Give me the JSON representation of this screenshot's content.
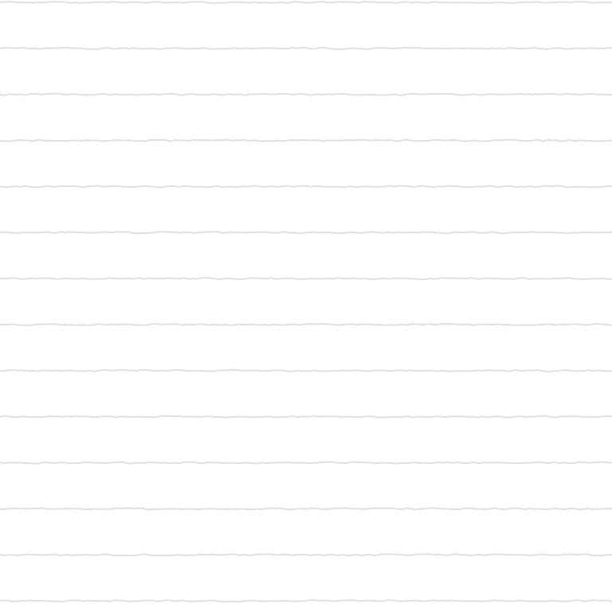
{
  "background_color": "#ffffff",
  "line_color": "#e2e0da",
  "line_count": 14
}
